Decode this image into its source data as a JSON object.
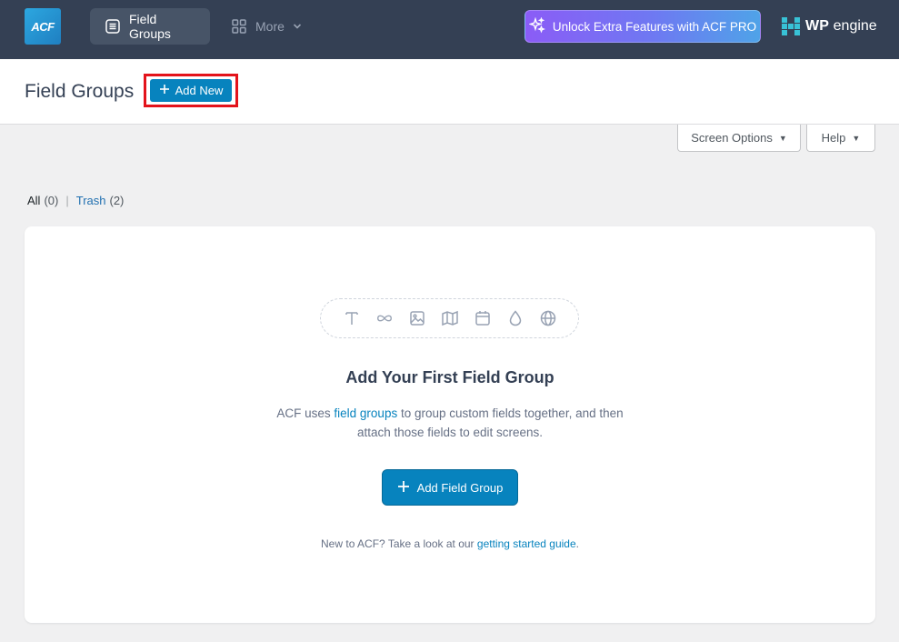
{
  "topbar": {
    "logo": "ACF",
    "tabs": [
      {
        "label": "Field Groups",
        "icon": "list-icon",
        "active": true
      },
      {
        "label": "More",
        "icon": "grid-icon",
        "active": false
      }
    ],
    "pro_button": "Unlock Extra Features with ACF PRO",
    "sponsor": {
      "bold": "WP",
      "rest": "engine"
    }
  },
  "header": {
    "title": "Field Groups",
    "add_new": "Add New"
  },
  "screen_meta": {
    "screen_options": "Screen Options",
    "help": "Help"
  },
  "filters": {
    "all": {
      "label": "All",
      "count": "(0)"
    },
    "separator": "|",
    "trash": {
      "label": "Trash",
      "count": "(2)"
    }
  },
  "empty_state": {
    "icons": [
      "text-icon",
      "infinity-icon",
      "image-icon",
      "map-icon",
      "calendar-icon",
      "drop-icon",
      "globe-icon"
    ],
    "title": "Add Your First Field Group",
    "desc_pre": "ACF uses ",
    "desc_link": "field groups",
    "desc_post": " to group custom fields together, and then attach those fields to edit screens.",
    "button": "Add Field Group",
    "foot_pre": "New to ACF? Take a look at our ",
    "foot_link": "getting started guide",
    "foot_post": "."
  },
  "colors": {
    "topbar": "#344054",
    "primary": "#0783be",
    "highlight": "#e3131b"
  }
}
